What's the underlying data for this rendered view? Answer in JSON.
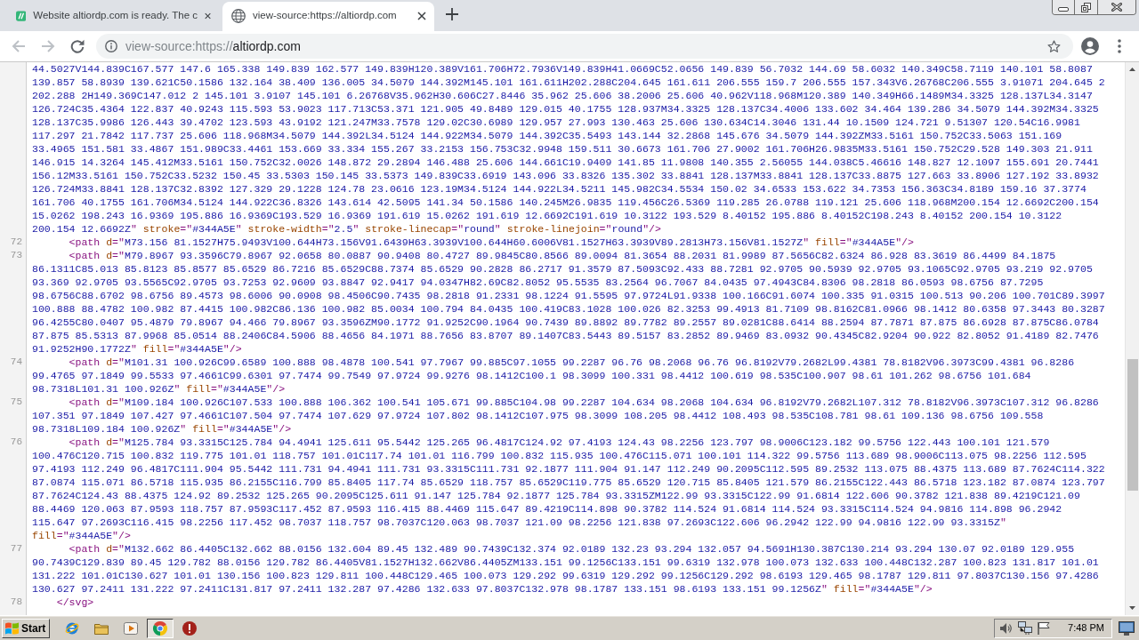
{
  "browser": {
    "tabs": [
      {
        "kind": "site",
        "title": "Website altiordp.com is ready. The c",
        "selected": false
      },
      {
        "kind": "page",
        "title": "view-source:https://altiordp.com",
        "selected": true
      }
    ],
    "nav": [
      {
        "kind": "back",
        "disabled": true
      },
      {
        "kind": "forward",
        "disabled": true
      },
      {
        "kind": "reload",
        "disabled": false
      }
    ],
    "address_bar": {
      "prefix": "view-source:https://",
      "host": "altiordp.com"
    }
  },
  "source": {
    "lines": [
      {
        "visual_lines": [
          {
            "parts": [
              {
                "kind": "value",
                "text": "44.5027V144.839C167.577 147.6 165.338 149.839 162.577 149.839H120.389V161.706H72.7936V149.839H41.0669C52.0656 149.839 56.7032 144.69 58.6032 140.349C58.7119 140.101 58.8087"
              }
            ]
          },
          {
            "parts": [
              {
                "kind": "value",
                "text": "139.857 58.8939 139.621C50.1586 132.164 38.409 136.005 34.5079 144.392M145.101 161.611H202.288C204.645 161.611 206.555 159.7 206.555 157.343V6.26768C206.555 3.91071 204.645 2"
              }
            ]
          },
          {
            "parts": [
              {
                "kind": "value",
                "text": "202.288 2H149.369C147.012 2 145.101 3.9107 145.101 6.26768V35.962H30.606C27.8446 35.962 25.606 38.2006 25.606 40.962V118.968M120.389 140.349H66.1489M34.3325 128.137L34.3147"
              }
            ]
          },
          {
            "parts": [
              {
                "kind": "value",
                "text": "126.724C35.4364 122.837 40.9243 115.593 53.9023 117.713C53.371 121.905 49.8489 129.015 40.1755 128.937M34.3325 128.137C34.4006 133.602 34.464 139.286 34.5079 144.392M34.3325"
              }
            ]
          },
          {
            "parts": [
              {
                "kind": "value",
                "text": "128.137C35.9986 126.443 39.4702 123.593 43.9192 121.247M33.7578 129.02C30.6989 129.957 27.993 130.463 25.606 130.634C14.3046 131.44 10.1509 124.721 9.51307 120.54C16.9981"
              }
            ]
          },
          {
            "parts": [
              {
                "kind": "value",
                "text": "117.297 21.7842 117.737 25.606 118.968M34.5079 144.392L34.5124 144.922M34.5079 144.392C35.5493 143.144 32.2868 145.676 34.5079 144.392ZM33.5161 150.752C33.5063 151.169"
              }
            ]
          },
          {
            "parts": [
              {
                "kind": "value",
                "text": "33.4965 151.581 33.4867 151.989C33.4461 153.669 33.334 155.267 33.2153 156.753C32.9948 159.511 30.6673 161.706 27.9002 161.706H26.9835M33.5161 150.752C29.528 149.303 21.911"
              }
            ]
          },
          {
            "parts": [
              {
                "kind": "value",
                "text": "146.915 14.3264 145.412M33.5161 150.752C32.0026 148.872 29.2894 146.488 25.606 144.661C19.9409 141.85 11.9808 140.355 2.56055 144.038C5.46616 148.827 12.1097 155.691 20.7441"
              }
            ]
          },
          {
            "parts": [
              {
                "kind": "value",
                "text": "156.12M33.5161 150.752C33.5232 150.45 33.5303 150.145 33.5373 149.839C33.6919 143.096 33.8326 135.302 33.8841 128.137M33.8841 128.137C33.8875 127.663 33.8906 127.192 33.8932"
              }
            ]
          },
          {
            "parts": [
              {
                "kind": "value",
                "text": "126.724M33.8841 128.137C32.8392 127.329 29.1228 124.78 23.0616 123.19M34.5124 144.922L34.5211 145.982C34.5534 150.02 34.6533 153.622 34.7353 156.363C34.8189 159.16 37.3774"
              }
            ]
          },
          {
            "parts": [
              {
                "kind": "value",
                "text": "161.706 40.1755 161.706M34.5124 144.922C36.8326 143.614 42.5095 141.34 50.1586 140.245M26.9835 119.456C26.5369 119.285 26.0788 119.121 25.606 118.968M200.154 12.6692C200.154"
              }
            ]
          },
          {
            "parts": [
              {
                "kind": "value",
                "text": "15.0262 198.243 16.9369 195.886 16.9369C193.529 16.9369 191.619 15.0262 191.619 12.6692C191.619 10.3122 193.529 8.40152 195.886 8.40152C198.243 8.40152 200.154 10.3122"
              }
            ]
          },
          {
            "parts": [
              {
                "kind": "value",
                "text": "200.154 12.6692Z"
              },
              {
                "kind": "tag",
                "text": "\""
              },
              {
                "kind": "attr",
                "text": " stroke"
              },
              {
                "kind": "tag",
                "text": "=\""
              },
              {
                "kind": "value",
                "text": "#344A5E"
              },
              {
                "kind": "tag",
                "text": "\""
              },
              {
                "kind": "attr",
                "text": " stroke-width"
              },
              {
                "kind": "tag",
                "text": "=\""
              },
              {
                "kind": "value",
                "text": "2.5"
              },
              {
                "kind": "tag",
                "text": "\""
              },
              {
                "kind": "attr",
                "text": " stroke-linecap"
              },
              {
                "kind": "tag",
                "text": "=\""
              },
              {
                "kind": "value",
                "text": "round"
              },
              {
                "kind": "tag",
                "text": "\""
              },
              {
                "kind": "attr",
                "text": " stroke-linejoin"
              },
              {
                "kind": "tag",
                "text": "=\""
              },
              {
                "kind": "value",
                "text": "round"
              },
              {
                "kind": "tag",
                "text": "\"/>"
              }
            ]
          }
        ]
      },
      {
        "number": "72",
        "visual_lines": [
          {
            "parts": [
              {
                "kind": "tag",
                "text": "      <path"
              },
              {
                "kind": "attr",
                "text": " d"
              },
              {
                "kind": "tag",
                "text": "=\""
              },
              {
                "kind": "value",
                "text": "M73.156 81.1527H75.9493V100.644H73.156V91.6439H63.3939V100.644H60.6006V81.1527H63.3939V89.2813H73.156V81.1527Z"
              },
              {
                "kind": "tag",
                "text": "\""
              },
              {
                "kind": "attr",
                "text": " fill"
              },
              {
                "kind": "tag",
                "text": "=\""
              },
              {
                "kind": "value",
                "text": "#344A5E"
              },
              {
                "kind": "tag",
                "text": "\"/>"
              }
            ]
          }
        ]
      },
      {
        "number": "73",
        "visual_lines": [
          {
            "parts": [
              {
                "kind": "tag",
                "text": "      <path"
              },
              {
                "kind": "attr",
                "text": " d"
              },
              {
                "kind": "tag",
                "text": "=\""
              },
              {
                "kind": "value",
                "text": "M79.8967 93.3596C79.8967 92.0658 80.0887 90.9408 80.4727 89.9845C80.8566 89.0094 81.3654 88.2031 81.9989 87.5656C82.6324 86.928 83.3619 86.4499 84.1875"
              }
            ]
          },
          {
            "parts": [
              {
                "kind": "value",
                "text": "86.1311C85.013 85.8123 85.8577 85.6529 86.7216 85.6529C88.7374 85.6529 90.2828 86.2717 91.3579 87.5093C92.433 88.7281 92.9705 90.5939 92.9705 93.1065C92.9705 93.219 92.9705"
              }
            ]
          },
          {
            "parts": [
              {
                "kind": "value",
                "text": "93.369 92.9705 93.5565C92.9705 93.7253 92.9609 93.8847 92.9417 94.0347H82.69C82.8052 95.5535 83.2564 96.7067 84.0435 97.4943C84.8306 98.2818 86.0593 98.6756 87.7295"
              }
            ]
          },
          {
            "parts": [
              {
                "kind": "value",
                "text": "98.6756C88.6702 98.6756 89.4573 98.6006 90.0908 98.4506C90.7435 98.2818 91.2331 98.1224 91.5595 97.9724L91.9338 100.166C91.6074 100.335 91.0315 100.513 90.206 100.701C89.3997"
              }
            ]
          },
          {
            "parts": [
              {
                "kind": "value",
                "text": "100.888 88.4782 100.982 87.4415 100.982C86.136 100.982 85.0034 100.794 84.0435 100.419C83.1028 100.026 82.3253 99.4913 81.7109 98.8162C81.0966 98.1412 80.6358 97.3443 80.3287"
              }
            ]
          },
          {
            "parts": [
              {
                "kind": "value",
                "text": "96.4255C80.0407 95.4879 79.8967 94.466 79.8967 93.3596ZM90.1772 91.9252C90.1964 90.7439 89.8892 89.7782 89.2557 89.0281C88.6414 88.2594 87.7871 87.875 86.6928 87.875C86.0784"
              }
            ]
          },
          {
            "parts": [
              {
                "kind": "value",
                "text": "87.875 85.5313 87.9968 85.0514 88.2406C84.5906 88.4656 84.1971 88.7656 83.8707 89.1407C83.5443 89.5157 83.2852 89.9469 83.0932 90.4345C82.9204 90.922 82.8052 91.4189 82.7476"
              }
            ]
          },
          {
            "parts": [
              {
                "kind": "value",
                "text": "91.9252H90.1772Z"
              },
              {
                "kind": "tag",
                "text": "\""
              },
              {
                "kind": "attr",
                "text": " fill"
              },
              {
                "kind": "tag",
                "text": "=\""
              },
              {
                "kind": "value",
                "text": "#344A5E"
              },
              {
                "kind": "tag",
                "text": "\"/>"
              }
            ]
          }
        ]
      },
      {
        "number": "74",
        "visual_lines": [
          {
            "parts": [
              {
                "kind": "tag",
                "text": "      <path"
              },
              {
                "kind": "attr",
                "text": " d"
              },
              {
                "kind": "tag",
                "text": "=\""
              },
              {
                "kind": "value",
                "text": "M101.31 100.926C99.6589 100.888 98.4878 100.541 97.7967 99.885C97.1055 99.2287 96.76 98.2068 96.76 96.8192V79.2682L99.4381 78.8182V96.3973C99.4381 96.8286"
              }
            ]
          },
          {
            "parts": [
              {
                "kind": "value",
                "text": "99.4765 97.1849 99.5533 97.4661C99.6301 97.7474 99.7549 97.9724 99.9276 98.1412C100.1 98.3099 100.331 98.4412 100.619 98.535C100.907 98.61 101.262 98.6756 101.684"
              }
            ]
          },
          {
            "parts": [
              {
                "kind": "value",
                "text": "98.7318L101.31 100.926Z"
              },
              {
                "kind": "tag",
                "text": "\""
              },
              {
                "kind": "attr",
                "text": " fill"
              },
              {
                "kind": "tag",
                "text": "=\""
              },
              {
                "kind": "value",
                "text": "#344A5E"
              },
              {
                "kind": "tag",
                "text": "\"/>"
              }
            ]
          }
        ]
      },
      {
        "number": "75",
        "visual_lines": [
          {
            "parts": [
              {
                "kind": "tag",
                "text": "      <path"
              },
              {
                "kind": "attr",
                "text": " d"
              },
              {
                "kind": "tag",
                "text": "=\""
              },
              {
                "kind": "value",
                "text": "M109.184 100.926C107.533 100.888 106.362 100.541 105.671 99.885C104.98 99.2287 104.634 98.2068 104.634 96.8192V79.2682L107.312 78.8182V96.3973C107.312 96.8286"
              }
            ]
          },
          {
            "parts": [
              {
                "kind": "value",
                "text": "107.351 97.1849 107.427 97.4661C107.504 97.7474 107.629 97.9724 107.802 98.1412C107.975 98.3099 108.205 98.4412 108.493 98.535C108.781 98.61 109.136 98.6756 109.558"
              }
            ]
          },
          {
            "parts": [
              {
                "kind": "value",
                "text": "98.7318L109.184 100.926Z"
              },
              {
                "kind": "tag",
                "text": "\""
              },
              {
                "kind": "attr",
                "text": " fill"
              },
              {
                "kind": "tag",
                "text": "=\""
              },
              {
                "kind": "value",
                "text": "#344A5E"
              },
              {
                "kind": "tag",
                "text": "\"/>"
              }
            ]
          }
        ]
      },
      {
        "number": "76",
        "visual_lines": [
          {
            "parts": [
              {
                "kind": "tag",
                "text": "      <path"
              },
              {
                "kind": "attr",
                "text": " d"
              },
              {
                "kind": "tag",
                "text": "=\""
              },
              {
                "kind": "value",
                "text": "M125.784 93.3315C125.784 94.4941 125.611 95.5442 125.265 96.4817C124.92 97.4193 124.43 98.2256 123.797 98.9006C123.182 99.5756 122.443 100.101 121.579"
              }
            ]
          },
          {
            "parts": [
              {
                "kind": "value",
                "text": "100.476C120.715 100.832 119.775 101.01 118.757 101.01C117.74 101.01 116.799 100.832 115.935 100.476C115.071 100.101 114.322 99.5756 113.689 98.9006C113.075 98.2256 112.595"
              }
            ]
          },
          {
            "parts": [
              {
                "kind": "value",
                "text": "97.4193 112.249 96.4817C111.904 95.5442 111.731 94.4941 111.731 93.3315C111.731 92.1877 111.904 91.147 112.249 90.2095C112.595 89.2532 113.075 88.4375 113.689 87.7624C114.322"
              }
            ]
          },
          {
            "parts": [
              {
                "kind": "value",
                "text": "87.0874 115.071 86.5718 115.935 86.2155C116.799 85.8405 117.74 85.6529 118.757 85.6529C119.775 85.6529 120.715 85.8405 121.579 86.2155C122.443 86.5718 123.182 87.0874 123.797"
              }
            ]
          },
          {
            "parts": [
              {
                "kind": "value",
                "text": "87.7624C124.43 88.4375 124.92 89.2532 125.265 90.2095C125.611 91.147 125.784 92.1877 125.784 93.3315ZM122.99 93.3315C122.99 91.6814 122.606 90.3782 121.838 89.4219C121.09"
              }
            ]
          },
          {
            "parts": [
              {
                "kind": "value",
                "text": "88.4469 120.063 87.9593 118.757 87.9593C117.452 87.9593 116.415 88.4469 115.647 89.4219C114.898 90.3782 114.524 91.6814 114.524 93.3315C114.524 94.9816 114.898 96.2942"
              }
            ]
          },
          {
            "parts": [
              {
                "kind": "value",
                "text": "115.647 97.2693C116.415 98.2256 117.452 98.7037 118.757 98.7037C120.063 98.7037 121.09 98.2256 121.838 97.2693C122.606 96.2942 122.99 94.9816 122.99 93.3315Z"
              },
              {
                "kind": "tag",
                "text": "\""
              }
            ]
          },
          {
            "parts": [
              {
                "kind": "attr",
                "text": "fill"
              },
              {
                "kind": "tag",
                "text": "=\""
              },
              {
                "kind": "value",
                "text": "#344A5E"
              },
              {
                "kind": "tag",
                "text": "\"/>"
              }
            ]
          }
        ]
      },
      {
        "number": "77",
        "visual_lines": [
          {
            "parts": [
              {
                "kind": "tag",
                "text": "      <path"
              },
              {
                "kind": "attr",
                "text": " d"
              },
              {
                "kind": "tag",
                "text": "=\""
              },
              {
                "kind": "value",
                "text": "M132.662 86.4405C132.662 88.0156 132.604 89.45 132.489 90.7439C132.374 92.0189 132.23 93.294 132.057 94.5691H130.387C130.214 93.294 130.07 92.0189 129.955"
              }
            ]
          },
          {
            "parts": [
              {
                "kind": "value",
                "text": "90.7439C129.839 89.45 129.782 88.0156 129.782 86.4405V81.1527H132.662V86.4405ZM133.151 99.1256C133.151 99.6319 132.978 100.073 132.633 100.448C132.287 100.823 131.817 101.01"
              }
            ]
          },
          {
            "parts": [
              {
                "kind": "value",
                "text": "131.222 101.01C130.627 101.01 130.156 100.823 129.811 100.448C129.465 100.073 129.292 99.6319 129.292 99.1256C129.292 98.6193 129.465 98.1787 129.811 97.8037C130.156 97.4286"
              }
            ]
          },
          {
            "parts": [
              {
                "kind": "value",
                "text": "130.627 97.2411 131.222 97.2411C131.817 97.2411 132.287 97.4286 132.633 97.8037C132.978 98.1787 133.151 98.6193 133.151 99.1256Z"
              },
              {
                "kind": "tag",
                "text": "\""
              },
              {
                "kind": "attr",
                "text": " fill"
              },
              {
                "kind": "tag",
                "text": "=\""
              },
              {
                "kind": "value",
                "text": "#344A5E"
              },
              {
                "kind": "tag",
                "text": "\"/>"
              }
            ]
          }
        ]
      },
      {
        "number": "78",
        "visual_lines": [
          {
            "parts": [
              {
                "kind": "tag",
                "text": "    </svg>"
              }
            ]
          }
        ]
      }
    ]
  },
  "taskbar": {
    "start": "Start",
    "apps": [
      {
        "kind": "globe",
        "selected": false
      },
      {
        "kind": "folder",
        "selected": false
      },
      {
        "kind": "player",
        "selected": false
      },
      {
        "kind": "wheel",
        "selected": true
      },
      {
        "kind": "alert",
        "selected": false
      }
    ],
    "clock": "7:48 PM"
  }
}
